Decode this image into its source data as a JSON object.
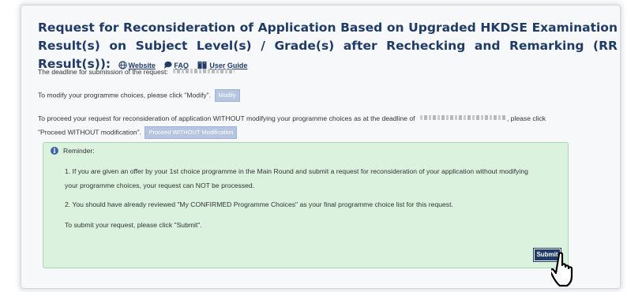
{
  "header": {
    "title": "Request for Reconsideration of Application Based on Upgraded HKDSE Examination Result(s) on Subject Level(s) / Grade(s) after Rechecking and Remarking (RR Result(s)):",
    "links": [
      {
        "label": "Website",
        "icon": "globe-icon"
      },
      {
        "label": "FAQ",
        "icon": "speech-bubble-icon"
      },
      {
        "label": "User Guide",
        "icon": "book-icon"
      }
    ]
  },
  "deadline": {
    "label": "The deadline for submission of the request:"
  },
  "modify": {
    "text": "To modify your programme choices, please click \"Modify\".",
    "button_label": "Modify"
  },
  "proceed": {
    "text_before": "To proceed your request for reconsideration of application WITHOUT modifying your programme choices as at the deadline of",
    "text_after": ", please click",
    "text_line2": "\"Proceed WITHOUT modification\".",
    "button_label": "Proceed WITHOUT Modification"
  },
  "reminder": {
    "heading": "Reminder:",
    "item1_line1": "1. If you are given an offer by your 1st choice programme in the Main Round and submit a request for reconsideration of your application without modifying",
    "item1_line2": "your programme choices, your request can NOT be processed.",
    "item2": "2. You should have already reviewed \"My CONFIRMED Programme Choices\" as your final programme choice list for this request.",
    "submit_text": "To submit your request, please click \"Submit\".",
    "submit_label": "Submit"
  },
  "colors": {
    "title": "#1f3b66",
    "reminder_bg": "#dbf2df",
    "submit_bg": "#1f3b66",
    "disabled_button": "#b6c6e0"
  }
}
